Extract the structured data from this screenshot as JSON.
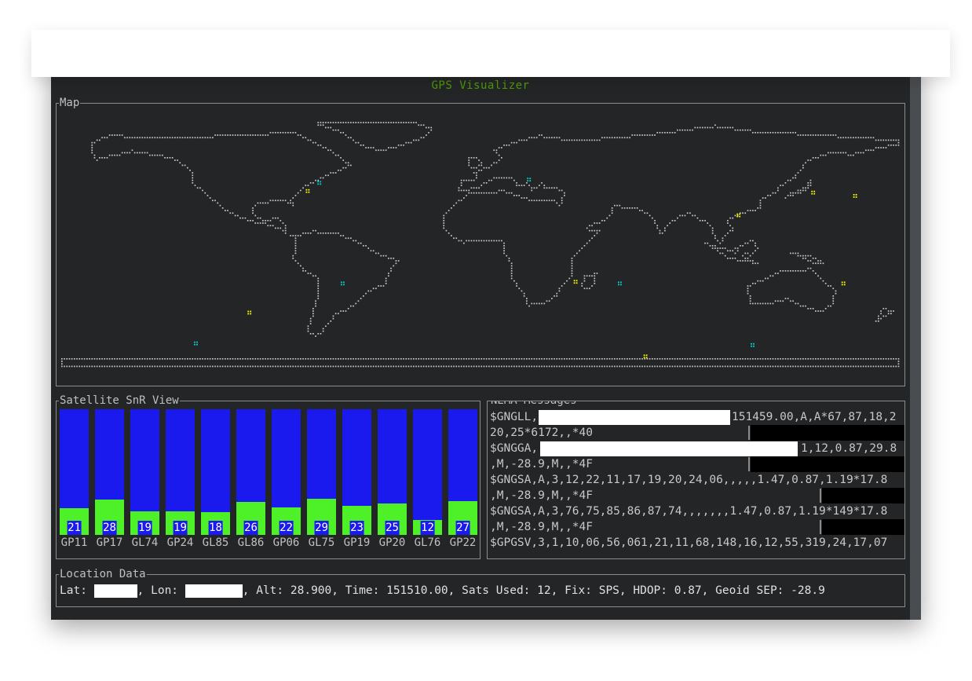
{
  "app": {
    "title": "GPS Visualizer"
  },
  "map": {
    "title": "Map",
    "colors": {
      "land": "#c8c8c8",
      "used_sat": "#ffff00",
      "visible_sat": "#00d7d7"
    },
    "satellites": [
      {
        "kind": "visible",
        "lat": 42,
        "lon": -70
      },
      {
        "kind": "used",
        "lat": 37,
        "lon": -75
      },
      {
        "kind": "visible",
        "lat": 44,
        "lon": 20
      },
      {
        "kind": "used",
        "lat": 36,
        "lon": 142
      },
      {
        "kind": "used",
        "lat": 34,
        "lon": 160
      },
      {
        "kind": "used",
        "lat": 22,
        "lon": 110
      },
      {
        "kind": "visible",
        "lat": -20,
        "lon": -60
      },
      {
        "kind": "used",
        "lat": -19,
        "lon": 40
      },
      {
        "kind": "visible",
        "lat": -20,
        "lon": 59
      },
      {
        "kind": "used",
        "lat": -20,
        "lon": 155
      },
      {
        "kind": "used",
        "lat": -38,
        "lon": -100
      },
      {
        "kind": "visible",
        "lat": -57,
        "lon": -123
      },
      {
        "kind": "visible",
        "lat": -58,
        "lon": 116
      },
      {
        "kind": "used",
        "lat": -65,
        "lon": 70
      }
    ]
  },
  "snr": {
    "title": "Satellite SnR View",
    "colors": {
      "bar": "#1a1aee",
      "fill": "#4ef028"
    },
    "max": 100,
    "satellites": [
      {
        "id": "GP11",
        "snr": 21
      },
      {
        "id": "GP17",
        "snr": 28
      },
      {
        "id": "GL74",
        "snr": 19
      },
      {
        "id": "GP24",
        "snr": 19
      },
      {
        "id": "GL85",
        "snr": 18
      },
      {
        "id": "GL86",
        "snr": 26
      },
      {
        "id": "GP06",
        "snr": 22
      },
      {
        "id": "GL75",
        "snr": 29
      },
      {
        "id": "GP19",
        "snr": 23
      },
      {
        "id": "GP20",
        "snr": 25
      },
      {
        "id": "GL76",
        "snr": 12
      },
      {
        "id": "GP22",
        "snr": 27
      }
    ]
  },
  "nema": {
    "title": "NEMA Messages",
    "lines": [
      {
        "text": "$GNGLL,",
        "tail": "151459.00,A,A*67,87,18,2"
      },
      {
        "text": "20,25*6172,,*40",
        "tail": ""
      },
      {
        "text": "$GNGGA,",
        "tail": "1,12,0.87,29.8"
      },
      {
        "text": ",M,-28.9,M,,*4F",
        "tail": ""
      },
      {
        "text": "$GNGSA,A,3,12,22,11,17,19,20,24,06,,,,,1.47,0.87,1.19*17.8",
        "tail": ""
      },
      {
        "text": ",M,-28.9,M,,*4F",
        "tail": ""
      },
      {
        "text": "$GNGSA,A,3,76,75,85,86,87,74,,,,,,,1.47,0.87,1.19*149*17.8",
        "tail": ""
      },
      {
        "text": ",M,-28.9,M,,*4F",
        "tail": ""
      },
      {
        "text": "$GPGSV,3,1,10,06,56,061,21,11,68,148,16,12,55,319,24,17,07",
        "tail": ""
      }
    ]
  },
  "location": {
    "title": "Location Data",
    "lat_label": "Lat: ",
    "lon_label": ", Lon: ",
    "rest": ", Alt: 28.900, Time: 151510.00, Sats Used: 12, Fix: SPS, HDOP: 0.87, Geoid SEP: -28.9"
  }
}
